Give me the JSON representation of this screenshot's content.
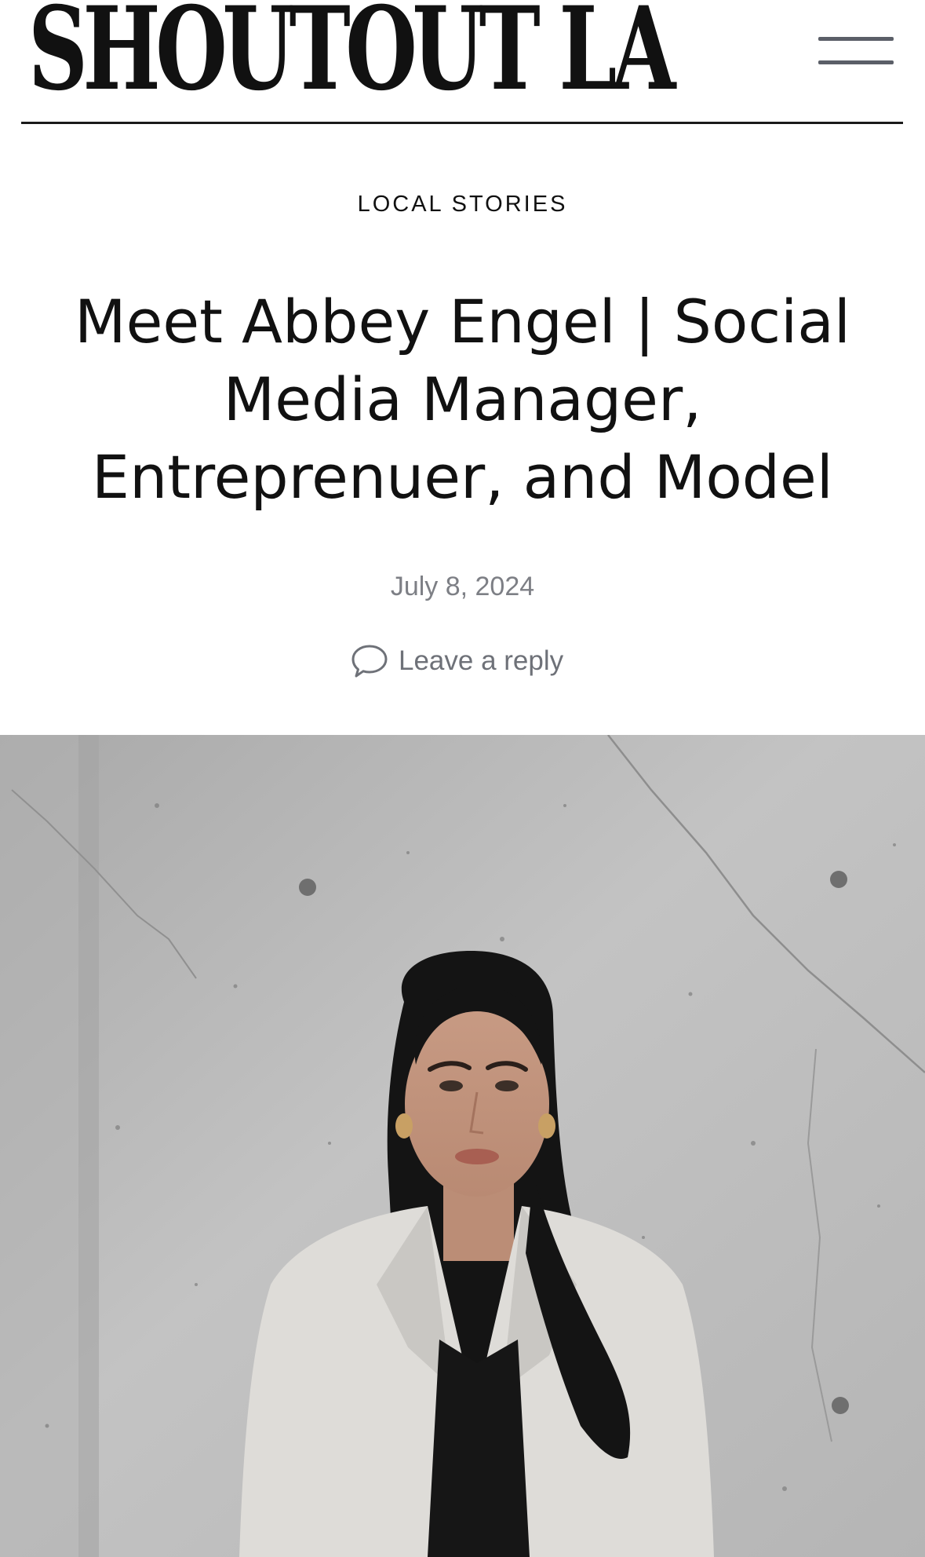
{
  "header": {
    "logo_text": "SHOUTOUT LA",
    "menu_icon": "hamburger-menu-icon"
  },
  "article": {
    "category": "LOCAL STORIES",
    "title": "Meet Abbey Engel | Social Media Manager, Entreprenuer, and Model",
    "date": "July 8, 2024",
    "reply_label": "Leave a reply",
    "reply_icon": "speech-bubble-icon"
  },
  "colors": {
    "text": "#111111",
    "meta_text": "#7d7f85",
    "menu_bar": "#5b5f68",
    "rule": "#1a1a1a"
  }
}
